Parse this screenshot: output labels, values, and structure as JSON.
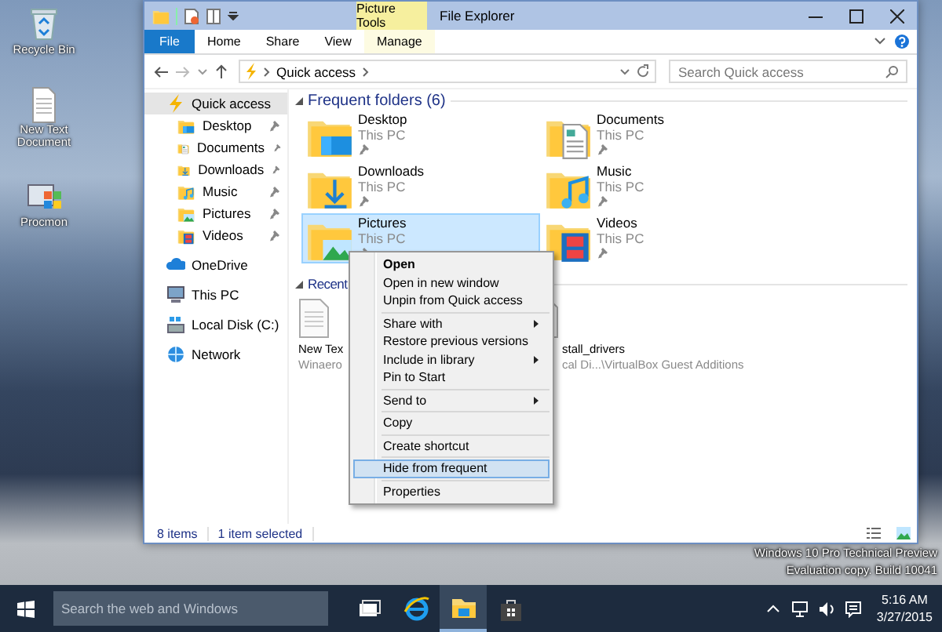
{
  "desktop_icons": [
    {
      "label": "Recycle Bin",
      "kind": "recycle"
    },
    {
      "label": "New Text Document",
      "kind": "text"
    },
    {
      "label": "Procmon",
      "kind": "app"
    }
  ],
  "window": {
    "title": "File Explorer",
    "contextual_group": "Picture Tools",
    "ribbon_tabs": [
      {
        "label": "File",
        "kind": "file",
        "selected": false
      },
      {
        "label": "Home",
        "kind": "tab",
        "selected": false
      },
      {
        "label": "Share",
        "kind": "tab",
        "selected": false
      },
      {
        "label": "View",
        "kind": "tab",
        "selected": false
      },
      {
        "label": "Manage",
        "kind": "contextual",
        "selected": false
      }
    ],
    "address": {
      "path": "Quick access"
    },
    "search": {
      "placeholder": "Search Quick access"
    },
    "nav": [
      {
        "label": "Quick access",
        "kind": "quick",
        "selected": true,
        "children": [
          {
            "label": "Desktop",
            "kind": "desktop",
            "pinned": true,
            "selected": false
          },
          {
            "label": "Documents",
            "kind": "documents",
            "pinned": true,
            "selected": false
          },
          {
            "label": "Downloads",
            "kind": "downloads",
            "pinned": true,
            "selected": false
          },
          {
            "label": "Music",
            "kind": "music",
            "pinned": true,
            "selected": false
          },
          {
            "label": "Pictures",
            "kind": "pictures",
            "pinned": true,
            "selected": false
          },
          {
            "label": "Videos",
            "kind": "videos",
            "pinned": true,
            "selected": false
          }
        ]
      },
      {
        "label": "OneDrive",
        "kind": "cloud",
        "selected": false
      },
      {
        "label": "This PC",
        "kind": "pc",
        "selected": false
      },
      {
        "label": "Local Disk (C:)",
        "kind": "drive",
        "selected": false
      },
      {
        "label": "Network",
        "kind": "network",
        "selected": false
      }
    ],
    "frequent": {
      "title": "Frequent folders (6)",
      "folders": [
        {
          "name": "Desktop",
          "location": "This PC",
          "kind": "desktop",
          "pinned": true,
          "selected": false
        },
        {
          "name": "Documents",
          "location": "This PC",
          "kind": "documents",
          "pinned": true,
          "selected": false
        },
        {
          "name": "Downloads",
          "location": "This PC",
          "kind": "downloads",
          "pinned": true,
          "selected": false
        },
        {
          "name": "Music",
          "location": "This PC",
          "kind": "music",
          "pinned": true,
          "selected": false
        },
        {
          "name": "Pictures",
          "location": "This PC",
          "kind": "pictures",
          "pinned": true,
          "selected": true
        },
        {
          "name": "Videos",
          "location": "This PC",
          "kind": "videos",
          "pinned": true,
          "selected": false
        }
      ]
    },
    "recent": {
      "title": "Recent",
      "files": [
        {
          "name": "New Tex",
          "location": "Winaero"
        },
        {
          "name": "stall_drivers",
          "location": "cal Di...\\VirtualBox Guest Additions"
        }
      ]
    },
    "status_bar": {
      "item_count": "8 items",
      "selection": "1 item selected"
    }
  },
  "context_menu": {
    "items": [
      {
        "kind": "item",
        "label": "Open",
        "default": true,
        "submenu": false,
        "selected": false
      },
      {
        "kind": "item",
        "label": "Open in new window",
        "default": false,
        "submenu": false,
        "selected": false
      },
      {
        "kind": "item",
        "label": "Unpin from Quick access",
        "default": false,
        "submenu": false,
        "selected": false
      },
      {
        "kind": "separator"
      },
      {
        "kind": "item",
        "label": "Share with",
        "default": false,
        "submenu": true,
        "selected": false
      },
      {
        "kind": "item",
        "label": "Restore previous versions",
        "default": false,
        "submenu": false,
        "selected": false
      },
      {
        "kind": "item",
        "label": "Include in library",
        "default": false,
        "submenu": true,
        "selected": false
      },
      {
        "kind": "item",
        "label": "Pin to Start",
        "default": false,
        "submenu": false,
        "selected": false
      },
      {
        "kind": "separator"
      },
      {
        "kind": "item",
        "label": "Send to",
        "default": false,
        "submenu": true,
        "selected": false
      },
      {
        "kind": "separator"
      },
      {
        "kind": "item",
        "label": "Copy",
        "default": false,
        "submenu": false,
        "selected": false
      },
      {
        "kind": "separator"
      },
      {
        "kind": "item",
        "label": "Create shortcut",
        "default": false,
        "submenu": false,
        "selected": false
      },
      {
        "kind": "separator"
      },
      {
        "kind": "item",
        "label": "Hide from frequent",
        "default": false,
        "submenu": false,
        "selected": true
      },
      {
        "kind": "separator"
      },
      {
        "kind": "item",
        "label": "Properties",
        "default": false,
        "submenu": false,
        "selected": false
      }
    ]
  },
  "system_notice": [
    "Windows 10 Pro Technical Preview",
    "Evaluation copy. Build 10041"
  ],
  "taskbar": {
    "search_placeholder": "Search the web and Windows",
    "apps": [
      {
        "kind": "taskview",
        "selected": false
      },
      {
        "kind": "browser",
        "selected": false
      },
      {
        "kind": "explorer",
        "selected": true
      },
      {
        "kind": "store",
        "selected": false
      }
    ],
    "time": "5:16 AM",
    "date": "3/27/2015"
  }
}
